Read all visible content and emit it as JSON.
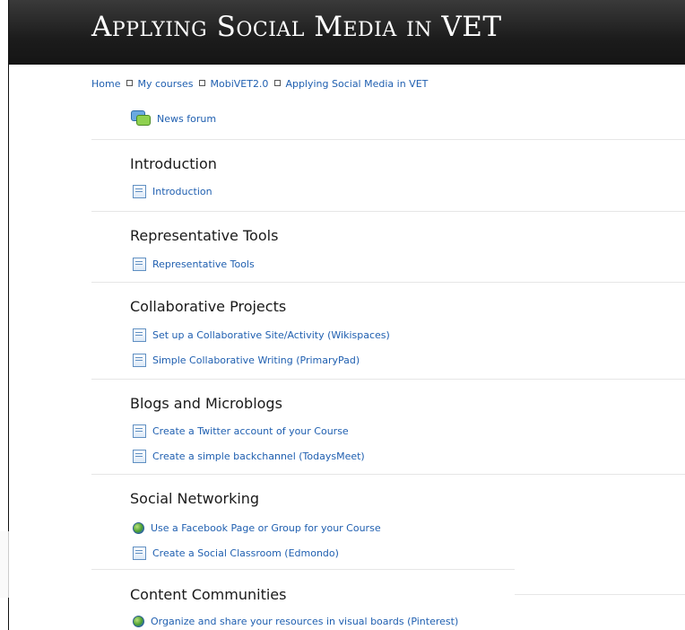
{
  "header": {
    "title": "Applying Social Media in VET"
  },
  "breadcrumb": [
    {
      "label": "Home"
    },
    {
      "label": "My courses"
    },
    {
      "label": "MobiVET2.0"
    },
    {
      "label": "Applying Social Media in VET"
    }
  ],
  "news_forum": {
    "label": "News forum",
    "icon": "forum-icon"
  },
  "sections": [
    {
      "title": "Introduction",
      "items": [
        {
          "label": "Introduction",
          "icon": "page-icon"
        }
      ]
    },
    {
      "title": "Representative Tools",
      "items": [
        {
          "label": "Representative Tools",
          "icon": "page-icon"
        }
      ]
    },
    {
      "title": "Collaborative Projects",
      "items": [
        {
          "label": "Set up a Collaborative Site/Activity (Wikispaces)",
          "icon": "page-icon"
        },
        {
          "label": "Simple Collaborative Writing (PrimaryPad)",
          "icon": "page-icon"
        }
      ]
    },
    {
      "title": "Blogs and Microblogs",
      "items": [
        {
          "label": "Create a Twitter account of your Course",
          "icon": "page-icon"
        },
        {
          "label": "Create a simple backchannel (TodaysMeet)",
          "icon": "page-icon"
        }
      ]
    },
    {
      "title": "Social Networking",
      "items": [
        {
          "label": "Use a Facebook Page or Group for your Course",
          "icon": "url-icon"
        },
        {
          "label": "Create a Social Classroom (Edmondo)",
          "icon": "page-icon"
        }
      ]
    },
    {
      "title": "Content Communities",
      "items": [
        {
          "label": "Organize and share your resources in visual boards (Pinterest)",
          "icon": "url-icon"
        }
      ]
    }
  ]
}
